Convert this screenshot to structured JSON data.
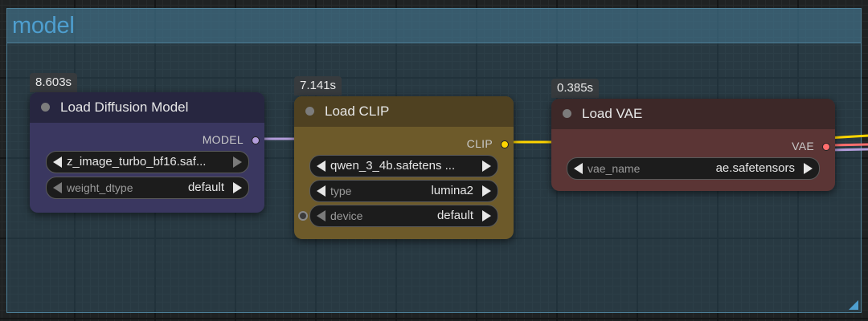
{
  "group": {
    "title": "model"
  },
  "nodes": {
    "diffusion": {
      "timing": "8.603s",
      "title": "Load Diffusion Model",
      "output": "MODEL",
      "widgets": {
        "unet_name": "z_image_turbo_bf16.saf...",
        "weight_dtype_name": "weight_dtype",
        "weight_dtype_value": "default"
      }
    },
    "clip": {
      "timing": "7.141s",
      "title": "Load CLIP",
      "output": "CLIP",
      "widgets": {
        "clip_name": "qwen_3_4b.safetens ...",
        "type_name": "type",
        "type_value": "lumina2",
        "device_name": "device",
        "device_value": "default"
      }
    },
    "vae": {
      "timing": "0.385s",
      "title": "Load VAE",
      "output": "VAE",
      "widgets": {
        "vae_name_name": "vae_name",
        "vae_name_value": "ae.safetensors"
      }
    }
  },
  "colors": {
    "model_link": "#b39ddb",
    "clip_link": "#ffd500",
    "vae_link": "#ff6e6e",
    "diffusion_body": "#3a3760",
    "diffusion_header": "#272640",
    "clip_body": "#6d5a2a",
    "clip_header": "#4f4121",
    "vae_body": "#5b3535",
    "vae_header": "#3d2828"
  }
}
